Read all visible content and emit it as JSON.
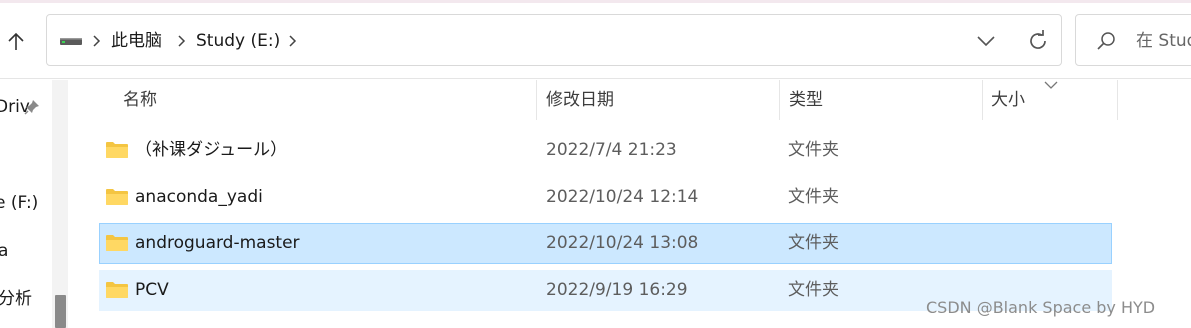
{
  "window": {
    "accent_selected": "#cce8ff",
    "accent_hover": "#e5f3ff"
  },
  "address_bar": {
    "breadcrumbs": [
      "此电脑",
      "Study (E:)"
    ],
    "drive_icon": "drive-icon",
    "dropdown_icon": "chevron-down-icon",
    "refresh_icon": "refresh-icon"
  },
  "search": {
    "placeholder": "在 Stud"
  },
  "nav_pane": {
    "items": [
      {
        "label": "Driv",
        "pinned": true
      },
      {
        "label": "e (F:)"
      },
      {
        "label": "a"
      },
      {
        "label": "分析"
      }
    ]
  },
  "columns": [
    "名称",
    "修改日期",
    "类型",
    "大小"
  ],
  "files": [
    {
      "name": "（补课ダジュール）",
      "modified": "2022/7/4 21:23",
      "type": "文件夹",
      "size": "",
      "state": "normal"
    },
    {
      "name": "anaconda_yadi",
      "modified": "2022/10/24 12:14",
      "type": "文件夹",
      "size": "",
      "state": "normal"
    },
    {
      "name": "androguard-master",
      "modified": "2022/10/24 13:08",
      "type": "文件夹",
      "size": "",
      "state": "selected"
    },
    {
      "name": "PCV",
      "modified": "2022/9/19 16:29",
      "type": "文件夹",
      "size": "",
      "state": "hover"
    }
  ],
  "watermark": "CSDN @Blank Space by HYD"
}
